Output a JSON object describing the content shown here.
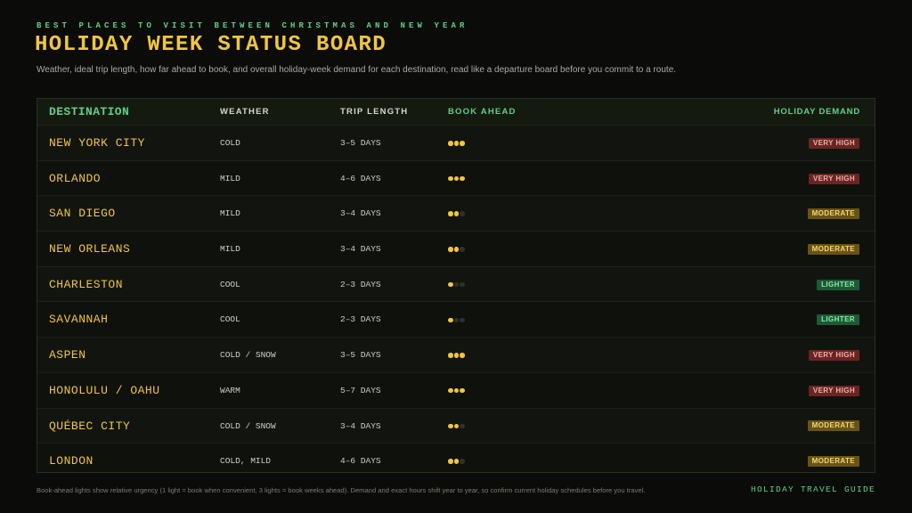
{
  "header": {
    "eyebrow": "BEST PLACES TO VISIT BETWEEN CHRISTMAS AND NEW YEAR",
    "title": "HOLIDAY WEEK STATUS BOARD",
    "subtitle": "Weather, ideal trip length, how far ahead to book, and overall holiday-week demand for each destination, read like a departure board before you commit to a route."
  },
  "table": {
    "columns": {
      "destination": "DESTINATION",
      "weather": "WEATHER",
      "trip_length": "TRIP LENGTH",
      "book_ahead": "BOOK AHEAD",
      "demand": "HOLIDAY DEMAND"
    },
    "book_ahead_max": 3,
    "rows": [
      {
        "destination": "NEW YORK CITY",
        "weather": "COLD",
        "trip_length": "3–5 DAYS",
        "book_ahead": 3,
        "demand": "VERY HIGH",
        "demand_level": "high"
      },
      {
        "destination": "ORLANDO",
        "weather": "MILD",
        "trip_length": "4–6 DAYS",
        "book_ahead": 3,
        "demand": "VERY HIGH",
        "demand_level": "high"
      },
      {
        "destination": "SAN DIEGO",
        "weather": "MILD",
        "trip_length": "3–4 DAYS",
        "book_ahead": 2,
        "demand": "MODERATE",
        "demand_level": "moderate"
      },
      {
        "destination": "NEW ORLEANS",
        "weather": "MILD",
        "trip_length": "3–4 DAYS",
        "book_ahead": 2,
        "demand": "MODERATE",
        "demand_level": "moderate"
      },
      {
        "destination": "CHARLESTON",
        "weather": "COOL",
        "trip_length": "2–3 DAYS",
        "book_ahead": 1,
        "demand": "LIGHTER",
        "demand_level": "lighter"
      },
      {
        "destination": "SAVANNAH",
        "weather": "COOL",
        "trip_length": "2–3 DAYS",
        "book_ahead": 1,
        "demand": "LIGHTER",
        "demand_level": "lighter"
      },
      {
        "destination": "ASPEN",
        "weather": "COLD / SNOW",
        "trip_length": "3–5 DAYS",
        "book_ahead": 3,
        "demand": "VERY HIGH",
        "demand_level": "high"
      },
      {
        "destination": "HONOLULU / OAHU",
        "weather": "WARM",
        "trip_length": "5–7 DAYS",
        "book_ahead": 3,
        "demand": "VERY HIGH",
        "demand_level": "high"
      },
      {
        "destination": "QUÉBEC CITY",
        "weather": "COLD / SNOW",
        "trip_length": "3–4 DAYS",
        "book_ahead": 2,
        "demand": "MODERATE",
        "demand_level": "moderate"
      },
      {
        "destination": "LONDON",
        "weather": "COLD, MILD",
        "trip_length": "4–6 DAYS",
        "book_ahead": 2,
        "demand": "MODERATE",
        "demand_level": "moderate"
      }
    ]
  },
  "footer": {
    "note": "Book-ahead lights show relative urgency (1 light = book when convenient, 3 lights = book weeks ahead). Demand and exact hours shift year to year, so confirm current holiday schedules before you travel.",
    "brand": "HOLIDAY TRAVEL GUIDE"
  },
  "colors": {
    "accent_green": "#5fcf86",
    "accent_yellow": "#f0c542",
    "very_high": "#6a2422",
    "moderate": "#6a5414",
    "lighter": "#1d5a35"
  }
}
